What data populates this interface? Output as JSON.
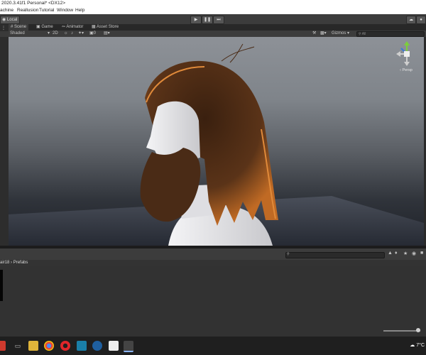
{
  "window": {
    "title": "2020.3.41f1 Personal* <DX12>"
  },
  "menu": {
    "items": [
      "achine",
      "Reallusion",
      "Tutorial",
      "Window",
      "Help"
    ]
  },
  "toolbar": {
    "pivot_label": "Local"
  },
  "tabs": [
    {
      "label": "Scene",
      "active": true
    },
    {
      "label": "Game",
      "active": false
    },
    {
      "label": "Animator",
      "active": false
    },
    {
      "label": "Asset Store",
      "active": false
    }
  ],
  "scene_toolbar": {
    "shading_mode": "Shaded",
    "mode_2d": "2D",
    "gizmos_label": "Gizmos",
    "search_placeholder": "All"
  },
  "scene_gizmo": {
    "projection_label": "‹ Persp"
  },
  "project": {
    "breadcrumb": [
      "air18",
      "Prefabs"
    ],
    "breadcrumb_separator": "›"
  },
  "colors": {
    "toolbar": "#3c3c3c",
    "panel": "#323232",
    "hair": "#5a3318",
    "hair_rim": "#e08a3a",
    "skin": "#e8e8ea"
  },
  "taskbar": {
    "temperature": "7°C"
  }
}
